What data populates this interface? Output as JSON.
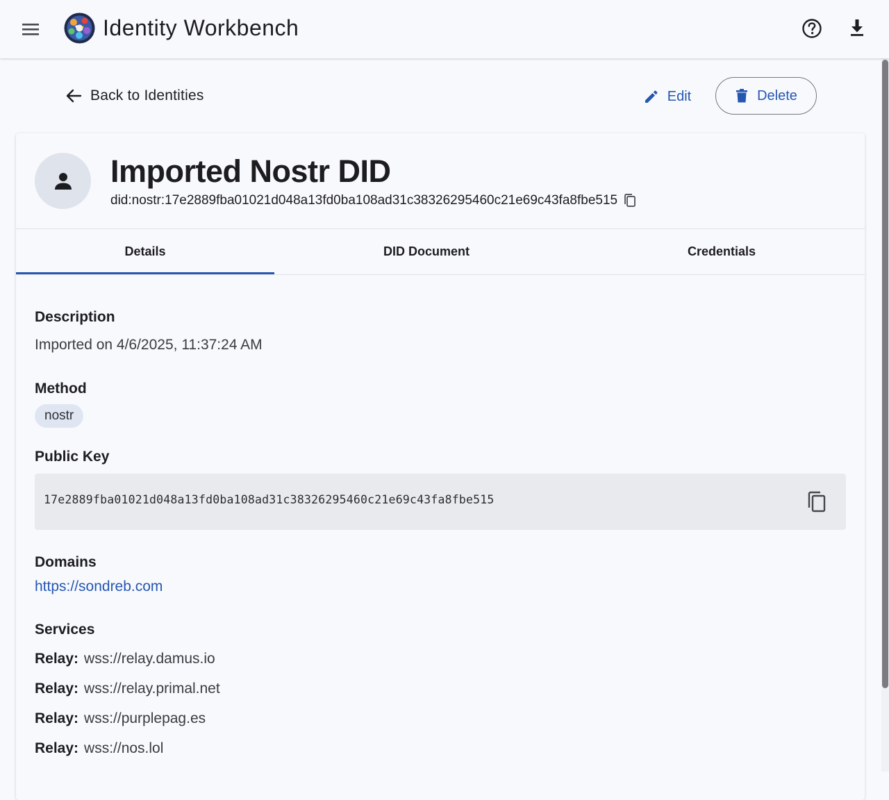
{
  "app": {
    "title": "Identity Workbench"
  },
  "nav": {
    "back_label": "Back to Identities"
  },
  "actions": {
    "edit_label": "Edit",
    "delete_label": "Delete"
  },
  "identity": {
    "name": "Imported Nostr DID",
    "did": "did:nostr:17e2889fba01021d048a13fd0ba108ad31c38326295460c21e69c43fa8fbe515"
  },
  "tabs": [
    {
      "label": "Details",
      "active": true
    },
    {
      "label": "DID Document",
      "active": false
    },
    {
      "label": "Credentials",
      "active": false
    }
  ],
  "details": {
    "description": {
      "label": "Description",
      "value": "Imported on 4/6/2025, 11:37:24 AM"
    },
    "method": {
      "label": "Method",
      "value": "nostr"
    },
    "public_key": {
      "label": "Public Key",
      "value": "17e2889fba01021d048a13fd0ba108ad31c38326295460c21e69c43fa8fbe515"
    },
    "domains": {
      "label": "Domains",
      "items": [
        "https://sondreb.com"
      ]
    },
    "services": {
      "label": "Services",
      "items": [
        {
          "type": "Relay:",
          "endpoint": "wss://relay.damus.io"
        },
        {
          "type": "Relay:",
          "endpoint": "wss://relay.primal.net"
        },
        {
          "type": "Relay:",
          "endpoint": "wss://purplepag.es"
        },
        {
          "type": "Relay:",
          "endpoint": "wss://nos.lol"
        }
      ]
    }
  },
  "colors": {
    "accent": "#2456b2",
    "background": "#f8f9fd",
    "chip": "#dfe6f2",
    "key_box": "#e9eaee"
  },
  "icons": [
    "menu-icon",
    "app-logo-icon",
    "help-icon",
    "download-icon",
    "arrow-back-icon",
    "edit-icon",
    "delete-icon",
    "person-icon",
    "copy-icon"
  ]
}
